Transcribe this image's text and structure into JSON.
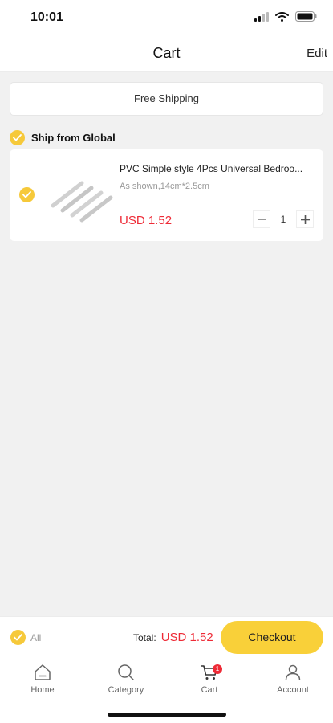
{
  "status_bar": {
    "time": "10:01"
  },
  "header": {
    "title": "Cart",
    "edit_label": "Edit"
  },
  "banner": {
    "text": "Free Shipping"
  },
  "group": {
    "label": "Ship from Global"
  },
  "cart_items": [
    {
      "title": "PVC Simple style 4Pcs Universal Bedroo...",
      "variant": "As shown,14cm*2.5cm",
      "price": "USD 1.52",
      "quantity": "1"
    }
  ],
  "footer": {
    "all_label": "All",
    "total_label": "Total:",
    "total_value": "USD 1.52",
    "checkout_label": "Checkout"
  },
  "tabs": [
    {
      "label": "Home"
    },
    {
      "label": "Category"
    },
    {
      "label": "Cart",
      "badge": "1"
    },
    {
      "label": "Account"
    }
  ],
  "colors": {
    "accent": "#f9d039",
    "price": "#ee2a36"
  }
}
